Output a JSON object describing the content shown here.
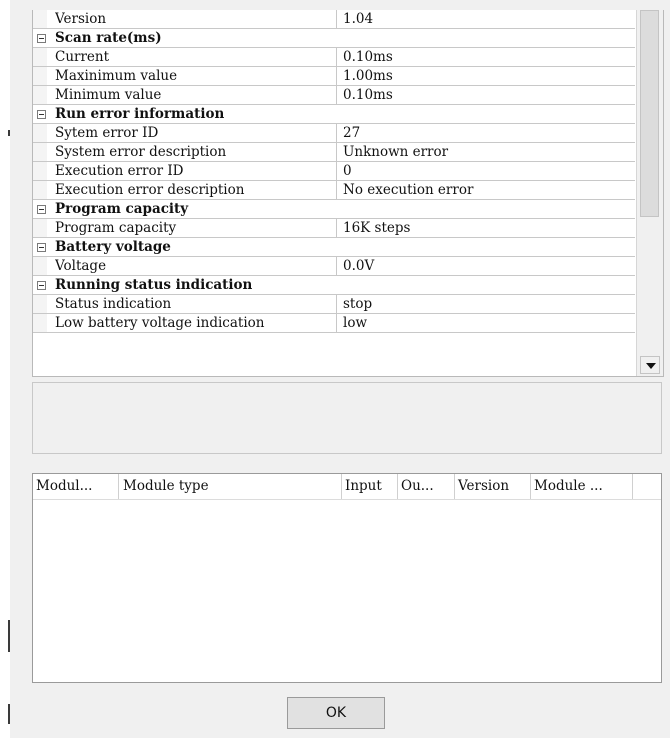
{
  "properties": {
    "rows": [
      {
        "kind": "item",
        "name": "Version",
        "value": "1.04"
      },
      {
        "kind": "cat",
        "name": "Scan rate(ms)"
      },
      {
        "kind": "item",
        "name": "Current",
        "value": "0.10ms"
      },
      {
        "kind": "item",
        "name": "Maxinimum value",
        "value": "1.00ms"
      },
      {
        "kind": "item",
        "name": "Minimum value",
        "value": "0.10ms"
      },
      {
        "kind": "cat",
        "name": "Run error information"
      },
      {
        "kind": "item",
        "name": "Sytem error ID",
        "value": "27"
      },
      {
        "kind": "item",
        "name": "System error description",
        "value": "Unknown error"
      },
      {
        "kind": "item",
        "name": "Execution error ID",
        "value": "0"
      },
      {
        "kind": "item",
        "name": "Execution error description",
        "value": "No execution error"
      },
      {
        "kind": "cat",
        "name": "Program capacity"
      },
      {
        "kind": "item",
        "name": "Program capacity",
        "value": "16K steps"
      },
      {
        "kind": "cat",
        "name": "Battery voltage"
      },
      {
        "kind": "item",
        "name": "Voltage",
        "value": "0.0V"
      },
      {
        "kind": "cat",
        "name": "Running status indication"
      },
      {
        "kind": "item",
        "name": "Status indication",
        "value": "stop"
      },
      {
        "kind": "item",
        "name": "Low battery voltage indication",
        "value": "low"
      }
    ]
  },
  "module_list": {
    "columns": [
      "Modul...",
      "Module type",
      "Input",
      "Ou...",
      "Version",
      "Module ..."
    ],
    "rows": []
  },
  "footer": {
    "ok_label": "OK"
  },
  "colors": {
    "background": "#f0f0f0",
    "grid_line": "#c8c8c8",
    "button": "#e1e1e1"
  }
}
